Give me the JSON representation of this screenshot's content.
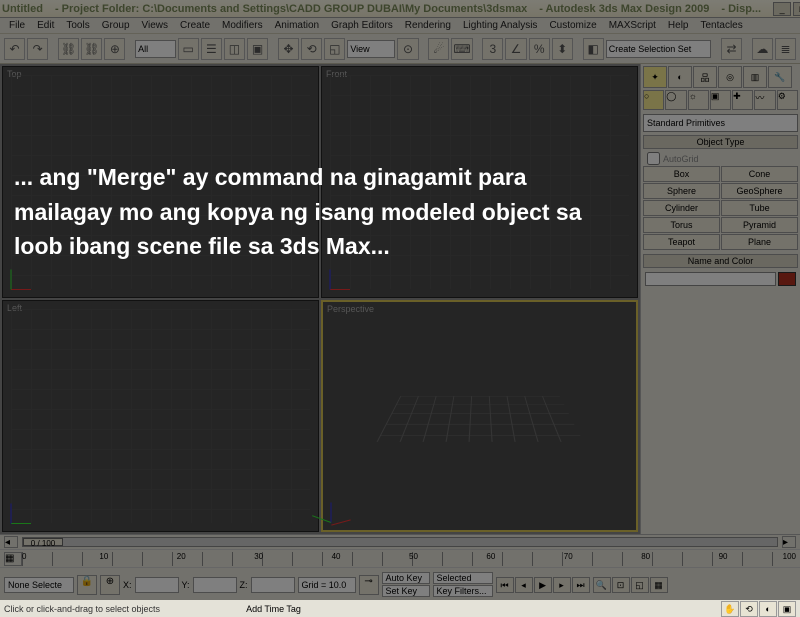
{
  "title": {
    "file": "Untitled",
    "folder": "- Project Folder: C:\\Documents and Settings\\CADD GROUP DUBAI\\My Documents\\3dsmax",
    "app": "- Autodesk 3ds Max Design 2009",
    "extra": "- Disp..."
  },
  "menu": [
    "File",
    "Edit",
    "Tools",
    "Group",
    "Views",
    "Create",
    "Modifiers",
    "Animation",
    "Graph Editors",
    "Rendering",
    "Lighting Analysis",
    "Customize",
    "MAXScript",
    "Help",
    "Tentacles"
  ],
  "toolbar": {
    "dropdown1": "All",
    "selset": "Create Selection Set"
  },
  "viewports": {
    "tl": "Top",
    "tr": "Front",
    "bl": "Left",
    "br": "Perspective"
  },
  "cmd": {
    "dropdown": "Standard Primitives",
    "rollout_obj": "Object Type",
    "autogrid": "AutoGrid",
    "buttons": [
      "Box",
      "Cone",
      "Sphere",
      "GeoSphere",
      "Cylinder",
      "Tube",
      "Torus",
      "Pyramid",
      "Teapot",
      "Plane"
    ],
    "rollout_name": "Name and Color"
  },
  "time": {
    "slider": "0 / 100",
    "ticks": [
      "0",
      "10",
      "20",
      "30",
      "40",
      "50",
      "60",
      "70",
      "80",
      "90",
      "100"
    ]
  },
  "status": {
    "selected": "None Selecte",
    "xl": "X:",
    "yl": "Y:",
    "zl": "Z:",
    "grid": "Grid = 10.0",
    "autokey": "Auto Key",
    "setkey": "Set Key",
    "selmode": "Selected",
    "keyfilt": "Key Filters...",
    "addtag": "Add Time Tag",
    "prompt": "Click or click-and-drag to select objects"
  },
  "overlay": "... ang \"Merge\" ay command na ginagamit para mailagay mo ang kopya ng isang modeled object sa loob ibang scene file sa 3ds Max..."
}
